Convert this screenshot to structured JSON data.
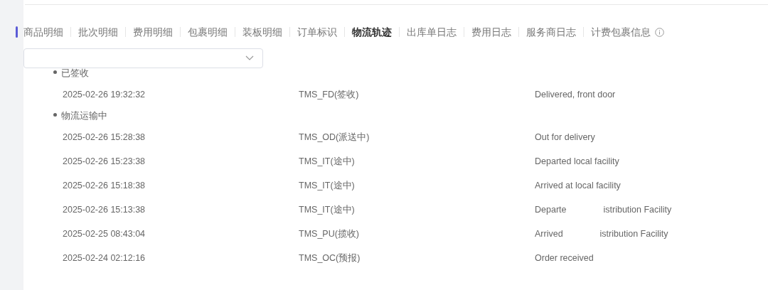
{
  "tabs": [
    {
      "label": "商品明细",
      "selected": false
    },
    {
      "label": "批次明细",
      "selected": false
    },
    {
      "label": "费用明细",
      "selected": false
    },
    {
      "label": "包裹明细",
      "selected": false
    },
    {
      "label": "装板明细",
      "selected": false
    },
    {
      "label": "订单标识",
      "selected": false
    },
    {
      "label": "物流轨迹",
      "selected": true
    },
    {
      "label": "出库单日志",
      "selected": false
    },
    {
      "label": "费用日志",
      "selected": false
    },
    {
      "label": "服务商日志",
      "selected": false
    },
    {
      "label": "计费包裹信息",
      "selected": false,
      "info": true
    }
  ],
  "groups": [
    {
      "status": "已签收",
      "events": [
        {
          "time": "2025-02-26 19:32:32",
          "code": "TMS_FD(签收)",
          "description": [
            "Delivered, front door"
          ]
        }
      ]
    },
    {
      "status": "物流运输中",
      "events": [
        {
          "time": "2025-02-26 15:28:38",
          "code": "TMS_OD(派送中)",
          "description": [
            "Out for delivery"
          ]
        },
        {
          "time": "2025-02-26 15:23:38",
          "code": "TMS_IT(途中)",
          "description": [
            "Departed local facility"
          ]
        },
        {
          "time": "2025-02-26 15:18:38",
          "code": "TMS_IT(途中)",
          "description": [
            "Arrived at local facility"
          ]
        },
        {
          "time": "2025-02-26 15:13:38",
          "code": "TMS_IT(途中)",
          "description": [
            "Departe",
            "istribution Facility"
          ]
        },
        {
          "time": "2025-02-25 08:43:04",
          "code": "TMS_PU(揽收)",
          "description": [
            "Arrived",
            "istribution Facility"
          ]
        },
        {
          "time": "2025-02-24 02:12:16",
          "code": "TMS_OC(预报)",
          "description": [
            "Order received"
          ]
        }
      ]
    }
  ]
}
